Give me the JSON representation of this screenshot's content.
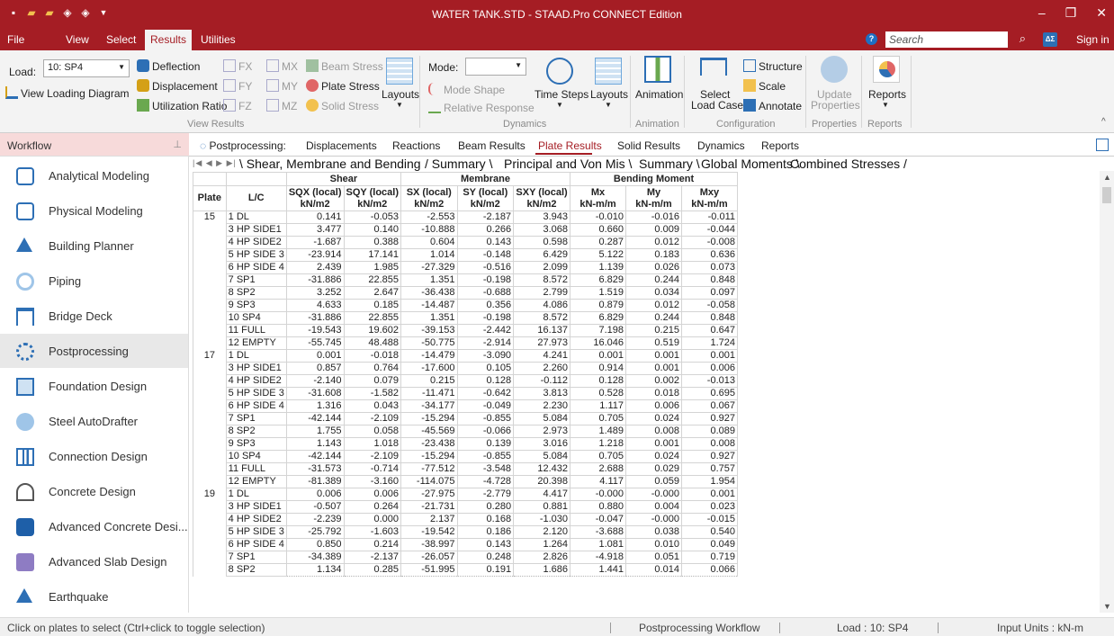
{
  "window": {
    "title": "WATER TANK.STD - STAAD.Pro CONNECT Edition",
    "minimize": "–",
    "restore": "❐",
    "close": "✕"
  },
  "menu": {
    "tabs": [
      "File",
      "View",
      "Select",
      "Results",
      "Utilities"
    ],
    "active_tab": "Results",
    "search_placeholder": "Search",
    "sign_in": "Sign in"
  },
  "ribbon": {
    "load_label": "Load:",
    "load_value": "10: SP4",
    "view_loading_diagram": "View Loading Diagram",
    "deflection": "Deflection",
    "displacement": "Displacement",
    "utilization_ratio": "Utilization Ratio",
    "fx": "FX",
    "fy": "FY",
    "fz": "FZ",
    "mx": "MX",
    "my": "MY",
    "mz": "MZ",
    "beam_stress": "Beam Stress",
    "plate_stress": "Plate Stress",
    "solid_stress": "Solid Stress",
    "layouts": "Layouts",
    "group_view_results": "View Results",
    "mode_label": "Mode:",
    "mode_shape": "Mode Shape",
    "relative_response": "Relative Response",
    "time_steps": "Time Steps",
    "layouts2": "Layouts",
    "group_dynamics": "Dynamics",
    "animation": "Animation",
    "group_animation": "Animation",
    "select_load_case_1": "Select",
    "select_load_case_2": "Load Case",
    "structure": "Structure",
    "scale": "Scale",
    "annotate": "Annotate",
    "group_configuration": "Configuration",
    "update_properties_1": "Update",
    "update_properties_2": "Properties",
    "group_properties": "Properties",
    "reports": "Reports",
    "group_reports": "Reports"
  },
  "workflow": {
    "title": "Workflow",
    "selected": "Postprocessing",
    "items": [
      "Analytical Modeling",
      "Physical Modeling",
      "Building Planner",
      "Piping",
      "Bridge Deck",
      "Postprocessing",
      "Foundation Design",
      "Steel AutoDrafter",
      "Connection Design",
      "Concrete Design",
      "Advanced Concrete Desi...",
      "Advanced Slab Design",
      "Earthquake"
    ]
  },
  "post_tabs": {
    "label": "Postprocessing:",
    "tabs": [
      "Displacements",
      "Reactions",
      "Beam Results",
      "Plate Results",
      "Solid Results",
      "Dynamics",
      "Reports"
    ],
    "active": "Plate Results"
  },
  "sheet_tabs": [
    "Shear, Membrane and Bending",
    "Summary",
    "Principal and Von Mis",
    "Summary",
    "Global Moments",
    "Combined Stresses"
  ],
  "table": {
    "group_headers": [
      "Shear",
      "Membrane",
      "Bending Moment"
    ],
    "col_plate": "Plate",
    "col_lc": "L/C",
    "columns": [
      {
        "name": "SQX (local)",
        "unit": "kN/m2"
      },
      {
        "name": "SQY (local)",
        "unit": "kN/m2"
      },
      {
        "name": "SX (local)",
        "unit": "kN/m2"
      },
      {
        "name": "SY (local)",
        "unit": "kN/m2"
      },
      {
        "name": "SXY (local)",
        "unit": "kN/m2"
      },
      {
        "name": "Mx",
        "unit": "kN-m/m"
      },
      {
        "name": "My",
        "unit": "kN-m/m"
      },
      {
        "name": "Mxy",
        "unit": "kN-m/m"
      }
    ],
    "rows": [
      [
        "15",
        "1 DL",
        "0.141",
        "-0.053",
        "-2.553",
        "-2.187",
        "3.943",
        "-0.010",
        "-0.016",
        "-0.011"
      ],
      [
        "",
        "3 HP SIDE1",
        "3.477",
        "0.140",
        "-10.888",
        "0.266",
        "3.068",
        "0.660",
        "0.009",
        "-0.044"
      ],
      [
        "",
        "4 HP SIDE2",
        "-1.687",
        "0.388",
        "0.604",
        "0.143",
        "0.598",
        "0.287",
        "0.012",
        "-0.008"
      ],
      [
        "",
        "5 HP SIDE 3",
        "-23.914",
        "17.141",
        "1.014",
        "-0.148",
        "6.429",
        "5.122",
        "0.183",
        "0.636"
      ],
      [
        "",
        "6 HP SIDE 4",
        "2.439",
        "1.985",
        "-27.329",
        "-0.516",
        "2.099",
        "1.139",
        "0.026",
        "0.073"
      ],
      [
        "",
        "7 SP1",
        "-31.886",
        "22.855",
        "1.351",
        "-0.198",
        "8.572",
        "6.829",
        "0.244",
        "0.848"
      ],
      [
        "",
        "8 SP2",
        "3.252",
        "2.647",
        "-36.438",
        "-0.688",
        "2.799",
        "1.519",
        "0.034",
        "0.097"
      ],
      [
        "",
        "9 SP3",
        "4.633",
        "0.185",
        "-14.487",
        "0.356",
        "4.086",
        "0.879",
        "0.012",
        "-0.058"
      ],
      [
        "",
        "10 SP4",
        "-31.886",
        "22.855",
        "1.351",
        "-0.198",
        "8.572",
        "6.829",
        "0.244",
        "0.848"
      ],
      [
        "",
        "11 FULL",
        "-19.543",
        "19.602",
        "-39.153",
        "-2.442",
        "16.137",
        "7.198",
        "0.215",
        "0.647"
      ],
      [
        "",
        "12 EMPTY",
        "-55.745",
        "48.488",
        "-50.775",
        "-2.914",
        "27.973",
        "16.046",
        "0.519",
        "1.724"
      ],
      [
        "17",
        "1 DL",
        "0.001",
        "-0.018",
        "-14.479",
        "-3.090",
        "4.241",
        "0.001",
        "0.001",
        "0.001"
      ],
      [
        "",
        "3 HP SIDE1",
        "0.857",
        "0.764",
        "-17.600",
        "0.105",
        "2.260",
        "0.914",
        "0.001",
        "0.006"
      ],
      [
        "",
        "4 HP SIDE2",
        "-2.140",
        "0.079",
        "0.215",
        "0.128",
        "-0.112",
        "0.128",
        "0.002",
        "-0.013"
      ],
      [
        "",
        "5 HP SIDE 3",
        "-31.608",
        "-1.582",
        "-11.471",
        "-0.642",
        "3.813",
        "0.528",
        "0.018",
        "0.695"
      ],
      [
        "",
        "6 HP SIDE 4",
        "1.316",
        "0.043",
        "-34.177",
        "-0.049",
        "2.230",
        "1.117",
        "0.006",
        "0.067"
      ],
      [
        "",
        "7 SP1",
        "-42.144",
        "-2.109",
        "-15.294",
        "-0.855",
        "5.084",
        "0.705",
        "0.024",
        "0.927"
      ],
      [
        "",
        "8 SP2",
        "1.755",
        "0.058",
        "-45.569",
        "-0.066",
        "2.973",
        "1.489",
        "0.008",
        "0.089"
      ],
      [
        "",
        "9 SP3",
        "1.143",
        "1.018",
        "-23.438",
        "0.139",
        "3.016",
        "1.218",
        "0.001",
        "0.008"
      ],
      [
        "",
        "10 SP4",
        "-42.144",
        "-2.109",
        "-15.294",
        "-0.855",
        "5.084",
        "0.705",
        "0.024",
        "0.927"
      ],
      [
        "",
        "11 FULL",
        "-31.573",
        "-0.714",
        "-77.512",
        "-3.548",
        "12.432",
        "2.688",
        "0.029",
        "0.757"
      ],
      [
        "",
        "12 EMPTY",
        "-81.389",
        "-3.160",
        "-114.075",
        "-4.728",
        "20.398",
        "4.117",
        "0.059",
        "1.954"
      ],
      [
        "19",
        "1 DL",
        "0.006",
        "0.006",
        "-27.975",
        "-2.779",
        "4.417",
        "-0.000",
        "-0.000",
        "0.001"
      ],
      [
        "",
        "3 HP SIDE1",
        "-0.507",
        "0.264",
        "-21.731",
        "0.280",
        "0.881",
        "0.880",
        "0.004",
        "0.023"
      ],
      [
        "",
        "4 HP SIDE2",
        "-2.239",
        "0.000",
        "2.137",
        "0.168",
        "-1.030",
        "-0.047",
        "-0.000",
        "-0.015"
      ],
      [
        "",
        "5 HP SIDE 3",
        "-25.792",
        "-1.603",
        "-19.542",
        "0.186",
        "2.120",
        "-3.688",
        "0.038",
        "0.540"
      ],
      [
        "",
        "6 HP SIDE 4",
        "0.850",
        "0.214",
        "-38.997",
        "0.143",
        "1.264",
        "1.081",
        "0.010",
        "0.049"
      ],
      [
        "",
        "7 SP1",
        "-34.389",
        "-2.137",
        "-26.057",
        "0.248",
        "2.826",
        "-4.918",
        "0.051",
        "0.719"
      ],
      [
        "",
        "8 SP2",
        "1.134",
        "0.285",
        "-51.995",
        "0.191",
        "1.686",
        "1.441",
        "0.014",
        "0.066"
      ]
    ]
  },
  "status": {
    "hint": "Click on plates to select (Ctrl+click to toggle selection)",
    "workflow": "Postprocessing Workflow",
    "load": "Load : 10: SP4",
    "units": "Input Units : kN-m"
  }
}
